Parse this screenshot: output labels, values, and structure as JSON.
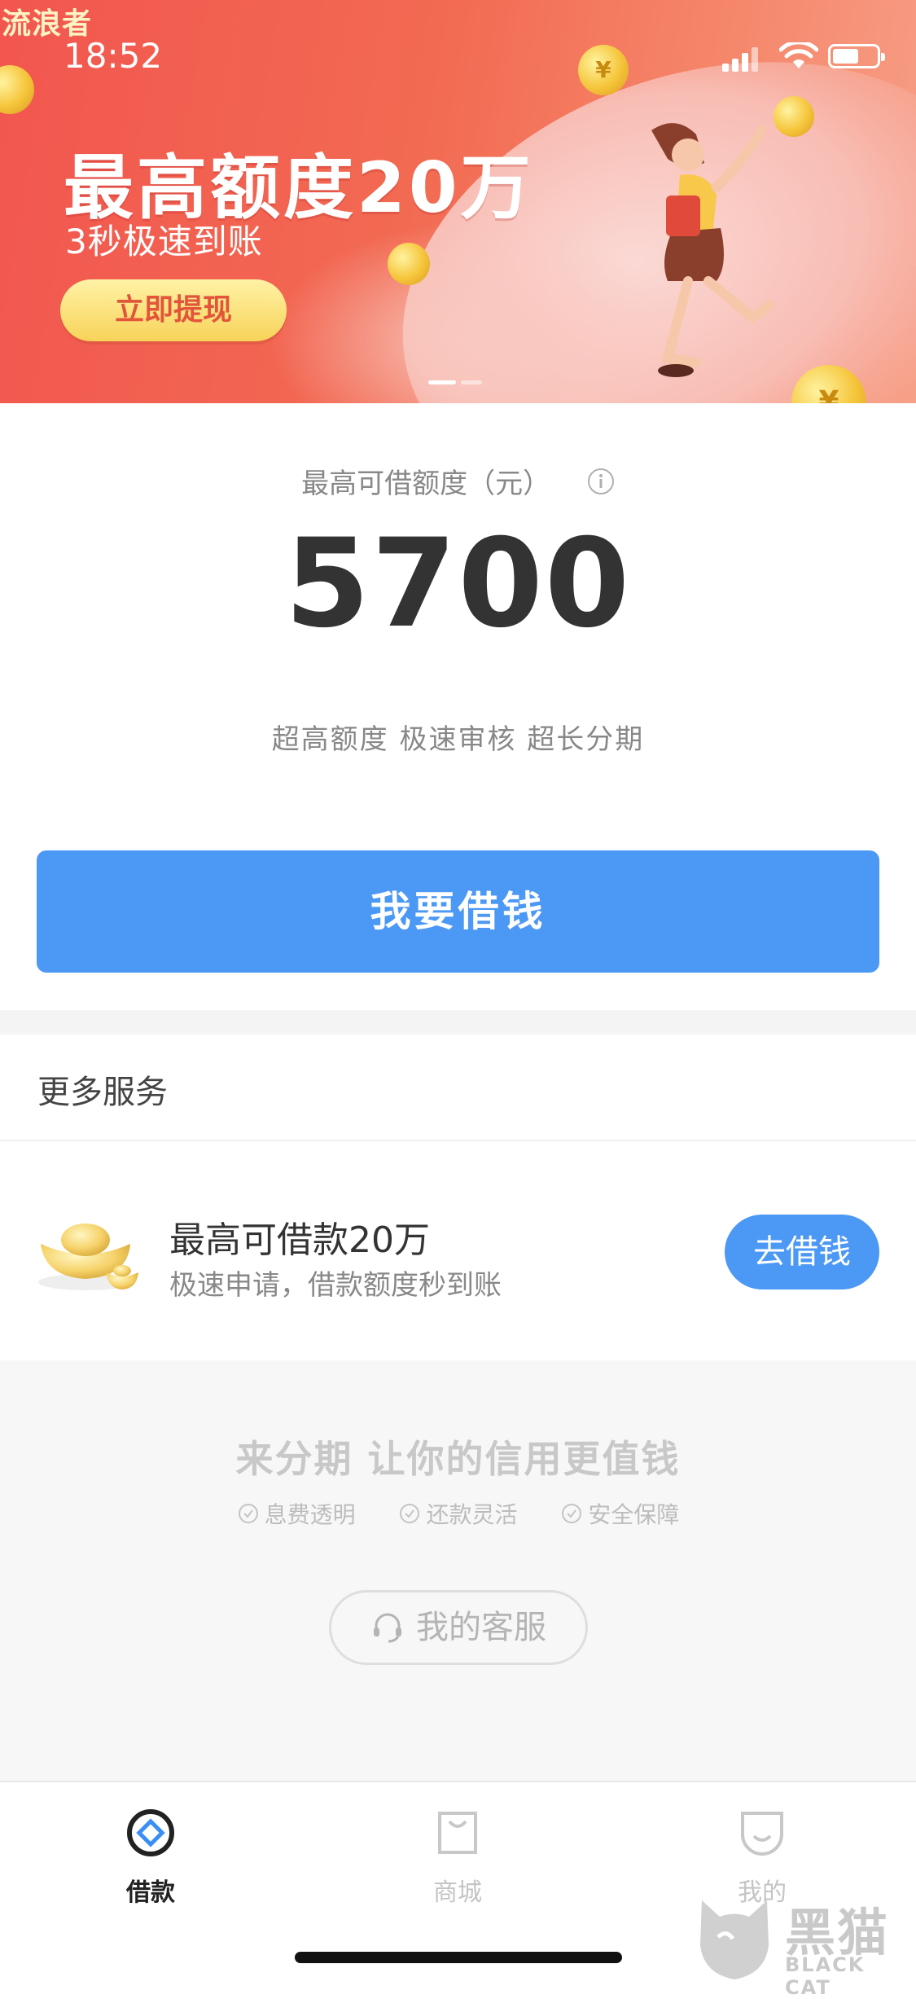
{
  "app": {
    "watermark_text": "流浪者",
    "logo_lettering": "黑猫 BLACK CAT"
  },
  "status_bar": {
    "time": "18:52",
    "battery_level": 0.6
  },
  "banner": {
    "title": "最高额度20万",
    "subtitle": "3秒极速到账",
    "cta_label": "立即提现",
    "page_count": 2,
    "active_page": 1,
    "colors": {
      "start": "#f2564f",
      "end": "#f7a088",
      "cta": "#f7d35a"
    }
  },
  "limit": {
    "label": "最高可借额度（元）",
    "value": "5700",
    "tags": "超高额度 极速审核 超长分期"
  },
  "primary_action": {
    "label": "我要借钱",
    "color": "#4b98f5"
  },
  "more_services": {
    "title": "更多服务",
    "items": [
      {
        "icon": "gold-ingot-icon",
        "title": "最高可借款20万",
        "desc": "极速申请，借款额度秒到账",
        "action": "去借钱"
      }
    ]
  },
  "footer": {
    "slogan": "来分期  让你的信用更值钱",
    "features": [
      "息费透明",
      "还款灵活",
      "安全保障"
    ],
    "customer_service": "我的客服"
  },
  "tabbar": {
    "tabs": [
      {
        "label": "借款",
        "icon": "loan-icon",
        "active": true
      },
      {
        "label": "商城",
        "icon": "shop-bag-icon",
        "active": false
      },
      {
        "label": "我的",
        "icon": "profile-smile-icon",
        "active": false
      }
    ]
  }
}
